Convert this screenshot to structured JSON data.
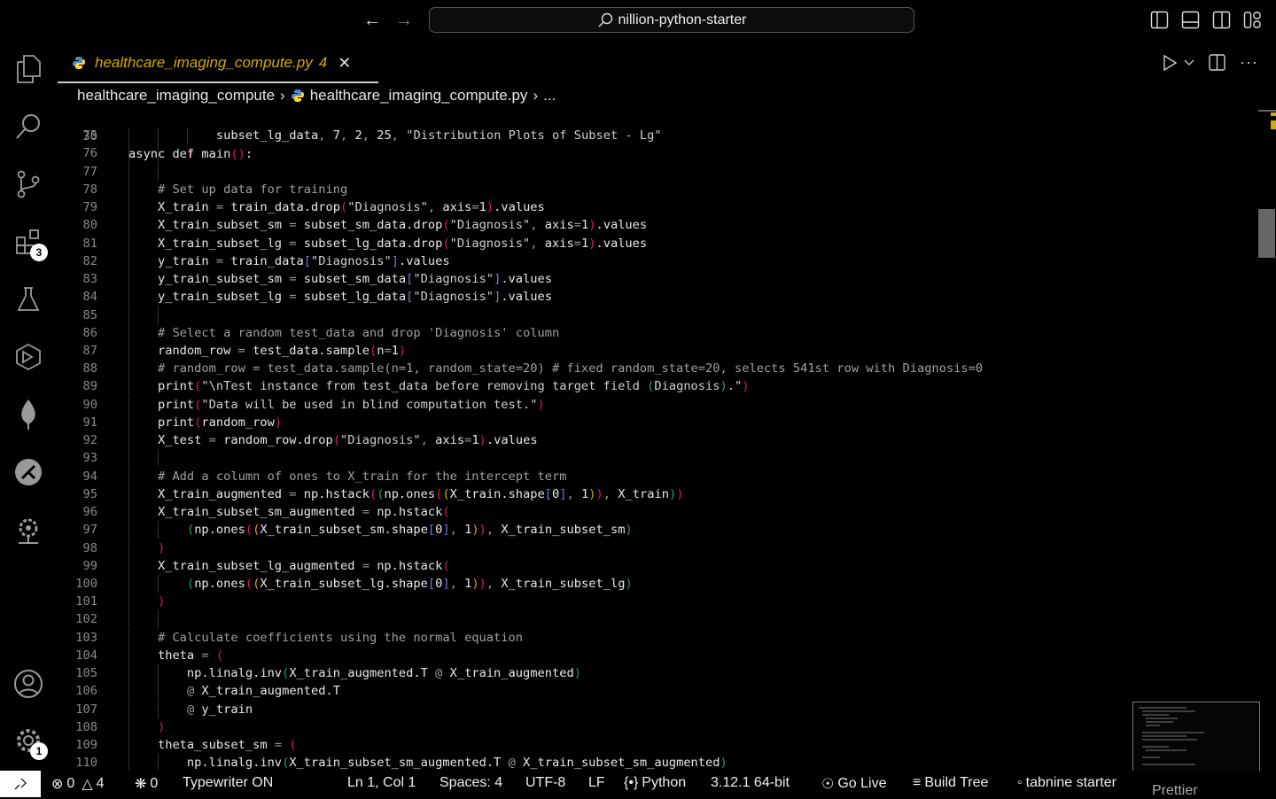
{
  "titlebar": {
    "search_text": "nillion-python-starter"
  },
  "activity_bar": {
    "items": [
      {
        "icon": "files-icon"
      },
      {
        "icon": "search-icon"
      },
      {
        "icon": "source-control-icon"
      },
      {
        "icon": "extensions-icon",
        "badge": "3"
      },
      {
        "icon": "testing-icon"
      },
      {
        "icon": "remote-explorer-icon"
      },
      {
        "icon": "mongodb-icon"
      },
      {
        "icon": "gitlens-icon"
      },
      {
        "icon": "kubernetes-icon"
      }
    ],
    "accounts_icon": "account-icon",
    "settings_badge": "1"
  },
  "tab": {
    "filename": "healthcare_imaging_compute.py",
    "problems": "4"
  },
  "breadcrumb": {
    "folder": "healthcare_imaging_compute",
    "file": "healthcare_imaging_compute.py",
    "more": "..."
  },
  "editor": {
    "sticky": {
      "n": "30",
      "text": "async def main():"
    },
    "lines": [
      {
        "n": "75",
        "text": "            subset_lg_data, 7, 2, 25, \"Distribution Plots of Subset - Lg\""
      },
      {
        "n": "76",
        "text": "        )"
      },
      {
        "n": "77",
        "text": ""
      },
      {
        "n": "78",
        "text": "    # Set up data for training"
      },
      {
        "n": "79",
        "text": "    X_train = train_data.drop(\"Diagnosis\", axis=1).values"
      },
      {
        "n": "80",
        "text": "    X_train_subset_sm = subset_sm_data.drop(\"Diagnosis\", axis=1).values"
      },
      {
        "n": "81",
        "text": "    X_train_subset_lg = subset_lg_data.drop(\"Diagnosis\", axis=1).values"
      },
      {
        "n": "82",
        "text": "    y_train = train_data[\"Diagnosis\"].values"
      },
      {
        "n": "83",
        "text": "    y_train_subset_sm = subset_sm_data[\"Diagnosis\"].values"
      },
      {
        "n": "84",
        "text": "    y_train_subset_lg = subset_lg_data[\"Diagnosis\"].values"
      },
      {
        "n": "85",
        "text": ""
      },
      {
        "n": "86",
        "text": "    # Select a random test_data and drop 'Diagnosis' column"
      },
      {
        "n": "87",
        "text": "    random_row = test_data.sample(n=1)"
      },
      {
        "n": "88",
        "text": "    # random_row = test_data.sample(n=1, random_state=20) # fixed random_state=20, selects 541st row with Diagnosis=0"
      },
      {
        "n": "89",
        "text": "    print(\"\\nTest instance from test_data before removing target field (Diagnosis).\")"
      },
      {
        "n": "90",
        "text": "    print(\"Data will be used in blind computation test.\")"
      },
      {
        "n": "91",
        "text": "    print(random_row)"
      },
      {
        "n": "92",
        "text": "    X_test = random_row.drop(\"Diagnosis\", axis=1).values"
      },
      {
        "n": "93",
        "text": ""
      },
      {
        "n": "94",
        "text": "    # Add a column of ones to X_train for the intercept term"
      },
      {
        "n": "95",
        "text": "    X_train_augmented = np.hstack((np.ones((X_train.shape[0], 1)), X_train))"
      },
      {
        "n": "96",
        "text": "    X_train_subset_sm_augmented = np.hstack("
      },
      {
        "n": "97",
        "text": "        (np.ones((X_train_subset_sm.shape[0], 1)), X_train_subset_sm)"
      },
      {
        "n": "98",
        "text": "    )"
      },
      {
        "n": "99",
        "text": "    X_train_subset_lg_augmented = np.hstack("
      },
      {
        "n": "100",
        "text": "        (np.ones((X_train_subset_lg.shape[0], 1)), X_train_subset_lg)"
      },
      {
        "n": "101",
        "text": "    )"
      },
      {
        "n": "102",
        "text": ""
      },
      {
        "n": "103",
        "text": "    # Calculate coefficients using the normal equation"
      },
      {
        "n": "104",
        "text": "    theta = ("
      },
      {
        "n": "105",
        "text": "        np.linalg.inv(X_train_augmented.T @ X_train_augmented)"
      },
      {
        "n": "106",
        "text": "        @ X_train_augmented.T"
      },
      {
        "n": "107",
        "text": "        @ y_train"
      },
      {
        "n": "108",
        "text": "    )"
      },
      {
        "n": "109",
        "text": "    theta_subset_sm = ("
      },
      {
        "n": "110",
        "text": "        np.linalg.inv(X_train_subset_sm_augmented.T @ X_train_subset_sm_augmented)"
      }
    ],
    "bracket_colors": [
      "#d81b60",
      "#2e9d5b",
      "#d81b60",
      "#d4a017"
    ],
    "square_bracket_color": "#6b7fd7"
  },
  "status": {
    "errors": "0",
    "warnings": "4",
    "ports": "0",
    "typewriter": "Typewriter ON",
    "position": "Ln 1, Col 1",
    "spaces": "Spaces: 4",
    "encoding": "UTF-8",
    "eol": "LF",
    "language": "Python",
    "interpreter": "3.12.1 64-bit",
    "go_live": "Go Live",
    "build_tree": "Build Tree",
    "tabnine": "tabnine starter",
    "prettier": "Prettier"
  }
}
